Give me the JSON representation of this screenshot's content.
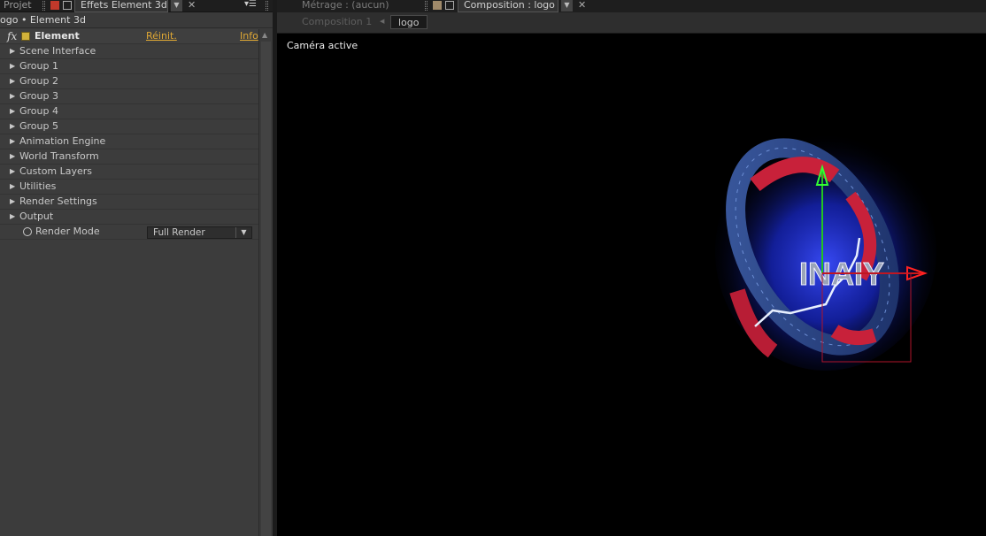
{
  "left_panel": {
    "tabs": {
      "projet": "Projet",
      "effets": "Effets Element 3d"
    },
    "header": "ogo • Element 3d",
    "effect": {
      "fx_label": "fx",
      "name": "Element",
      "reset": "Réinit.",
      "info": "Info"
    },
    "groups": [
      {
        "label": "Scene Interface"
      },
      {
        "label": "Group 1"
      },
      {
        "label": "Group 2"
      },
      {
        "label": "Group 3"
      },
      {
        "label": "Group 4"
      },
      {
        "label": "Group 5"
      },
      {
        "label": "Animation Engine"
      },
      {
        "label": "World Transform"
      },
      {
        "label": "Custom Layers"
      },
      {
        "label": "Utilities"
      },
      {
        "label": "Render Settings"
      },
      {
        "label": "Output"
      }
    ],
    "render_mode": {
      "label": "Render Mode",
      "value": "Full Render"
    }
  },
  "comp_panel": {
    "tabs": {
      "metrage": "Métrage : (aucun)",
      "composition": "Composition : logo"
    },
    "breadcrumb": {
      "parent": "Composition 1",
      "current": "logo"
    },
    "camera_label": "Caméra active",
    "logo_text": "INAIY"
  },
  "colors": {
    "accent_link": "#e0a834",
    "panel_bg": "#3c3c3c",
    "viewport_bg": "#000000",
    "ring_blue": "#2d4a86",
    "ring_red": "#c8213a"
  }
}
